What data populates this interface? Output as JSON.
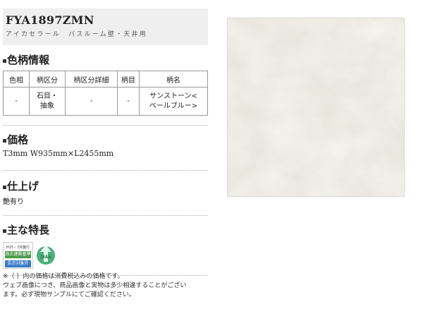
{
  "product": {
    "code": "FYA1897ZMN",
    "subtitle": "アイカセラール　バスルーム壁・天井用"
  },
  "pattern_section": {
    "title": "色柄情報",
    "headers": [
      "色相",
      "柄区分",
      "柄区分詳細",
      "柄目",
      "柄名"
    ],
    "row": {
      "hue": "-",
      "category_line1": "石目・",
      "category_line2": "抽象",
      "category_detail": "-",
      "grain": "-",
      "name_line1": "サンストーン<",
      "name_line2": "ペールブルー>"
    }
  },
  "price_section": {
    "title": "価格",
    "dimensions": "T3mm W935mm×L2455mm"
  },
  "finish_section": {
    "title": "仕上げ",
    "value": "艶有り"
  },
  "features_section": {
    "title": "主な特長",
    "badges": [
      {
        "top": "H15・7月施行",
        "mid": "改正建築基準法",
        "bottom": "告示対象外"
      },
      {
        "label": "SIAA"
      }
    ]
  },
  "note": {
    "line1": "※（ ）内の価格は消費税込みの価格です。",
    "line2": "ウェブ画像につき、商品画像と実物は多少相違することがござい",
    "line3": "ます。必ず現物サンプルにてご確認ください。"
  },
  "colors": {
    "header_bg": "#efefef",
    "badge_green": "#4c9a4a",
    "badge_blue": "#3a7bc8",
    "sample_base": "#e6e4db"
  }
}
